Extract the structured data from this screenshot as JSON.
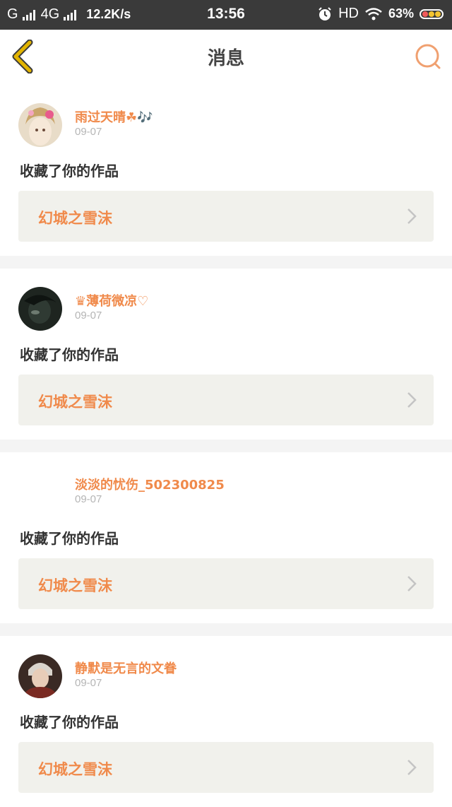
{
  "status_bar": {
    "carrier1": "G",
    "carrier2": "4G",
    "speed": "12.2K/s",
    "time": "13:56",
    "hd": "HD",
    "battery": "63%"
  },
  "header": {
    "title": "消息",
    "back_icon": "chevron-left-icon",
    "search_icon": "search-icon"
  },
  "colors": {
    "accent": "#f08a4b",
    "back_icon": "#e2b400"
  },
  "messages": [
    {
      "username": "雨过天晴☘🎶",
      "date": "09-07",
      "action": "收藏了你的作品",
      "work_title": "幻城之雪沫"
    },
    {
      "username": "♛薄荷微凉♡",
      "date": "09-07",
      "action": "收藏了你的作品",
      "work_title": "幻城之雪沫"
    },
    {
      "username": "淡淡的忧伤_502300825",
      "date": "09-07",
      "action": "收藏了你的作品",
      "work_title": "幻城之雪沫"
    },
    {
      "username": "静默是无言的文眷",
      "date": "09-07",
      "action": "收藏了你的作品",
      "work_title": "幻城之雪沫"
    }
  ]
}
